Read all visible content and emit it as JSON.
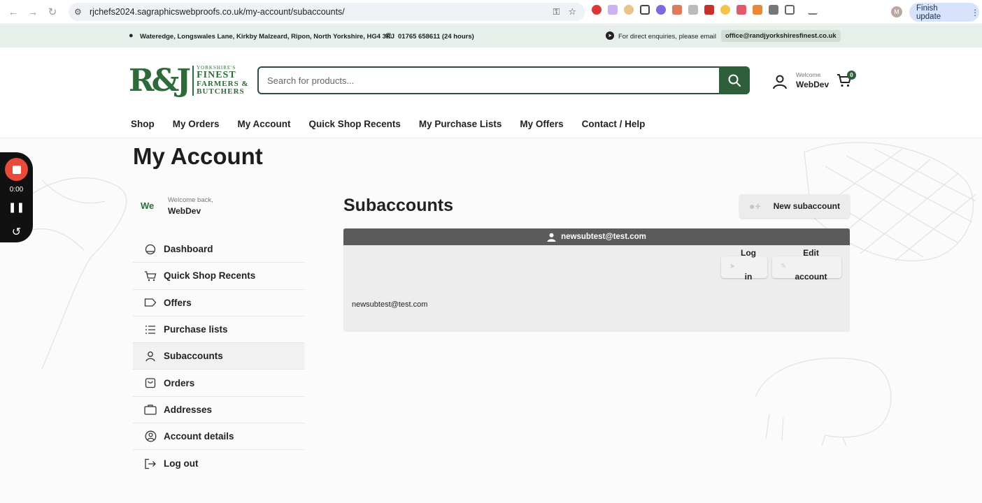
{
  "browser": {
    "url": "rjchefs2024.sagraphicswebproofs.co.uk/my-account/subaccounts/",
    "profile_initial": "M",
    "finish_update_label": "Finish update"
  },
  "infobar": {
    "address": "Wateredge, Longswales Lane, Kirkby Malzeard, Ripon, North Yorkshire, HG4 3RJ",
    "phone": "01765 658611 (24 hours)",
    "enquiries_label": "For direct enquiries, please email",
    "email": "office@randjyorkshiresfinest.co.uk"
  },
  "header": {
    "logo_mark": "R&J",
    "logo_line1": "YORKSHIRE'S",
    "logo_line2": "FINEST",
    "logo_line3": "FARMERS &",
    "logo_line4": "BUTCHERS",
    "search_placeholder": "Search for products...",
    "welcome_label": "Welcome",
    "user_name": "WebDev",
    "cart_count": "0",
    "nav": [
      "Shop",
      "My Orders",
      "My Account",
      "Quick Shop Recents",
      "My Purchase Lists",
      "My Offers",
      "Contact / Help"
    ]
  },
  "recorder": {
    "time": "0:00"
  },
  "account": {
    "page_title": "My Account",
    "initials": "We",
    "welcome_back": "Welcome back,",
    "user_name": "WebDev",
    "menu": [
      {
        "label": "Dashboard",
        "icon": "dashboard-icon"
      },
      {
        "label": "Quick Shop Recents",
        "icon": "cart-icon"
      },
      {
        "label": "Offers",
        "icon": "tag-icon"
      },
      {
        "label": "Purchase lists",
        "icon": "list-icon"
      },
      {
        "label": "Subaccounts",
        "icon": "user-icon"
      },
      {
        "label": "Orders",
        "icon": "shopping-bag-icon"
      },
      {
        "label": "Addresses",
        "icon": "briefcase-icon"
      },
      {
        "label": "Account details",
        "icon": "user-circle-icon"
      },
      {
        "label": "Log out",
        "icon": "logout-icon"
      }
    ],
    "active_item": "Subaccounts"
  },
  "subaccounts": {
    "title": "Subaccounts",
    "new_button": "New subaccount",
    "card": {
      "header_email": "newsubtest@test.com",
      "email": "newsubtest@test.com",
      "login_line1": "Log",
      "login_line2": "in",
      "edit_line1": "Edit",
      "edit_line2": "account"
    }
  },
  "colors": {
    "brand_green": "#2e6a3a",
    "infobar_bg": "#e6efea",
    "card_header": "#5b5b5b",
    "recorder_red": "#e84a3c"
  }
}
